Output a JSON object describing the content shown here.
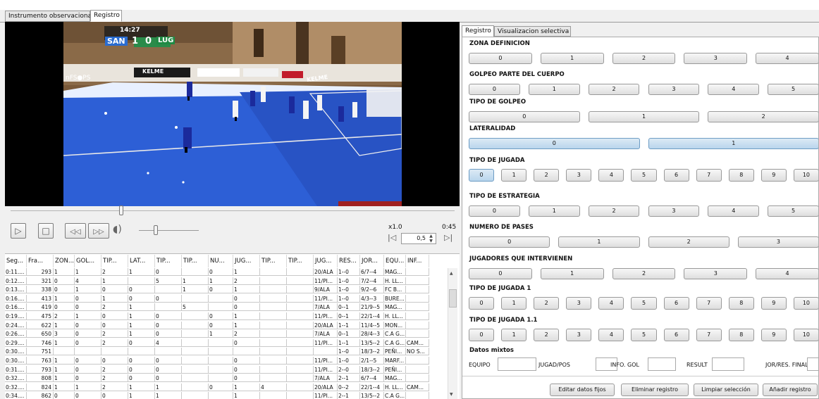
{
  "tabs": {
    "main": [
      "Instrumento observacional",
      "Registro"
    ],
    "right": [
      "Registro",
      "Visualizacion selectiva"
    ]
  },
  "video": {
    "scoreboard": {
      "time": "14:27",
      "home": "SAN",
      "home_score": "1",
      "away_score": "0",
      "away": "LUG"
    },
    "banners": [
      "KELME",
      "nFS●PS",
      "KELME"
    ]
  },
  "player": {
    "speed": "x1.0",
    "time": "0:45",
    "step": "0,5"
  },
  "table": {
    "headers": [
      "Seg...",
      "Fra...",
      "ZON...",
      "GOL...",
      "TIP...",
      "LAT...",
      "TIP...",
      "TIP...",
      "NU...",
      "JUG...",
      "TIP...",
      "TIP...",
      "JUG...",
      "RES...",
      "JOR...",
      "EQU...",
      "INF..."
    ],
    "rows": [
      [
        "0:11....",
        "293",
        "1",
        "1",
        "2",
        "1",
        "0",
        "",
        "0",
        "1",
        "",
        "",
        "20/ALA",
        "1--0",
        "6/7--4",
        "MAG...",
        ""
      ],
      [
        "0:12....",
        "321",
        "0",
        "4",
        "1",
        "",
        "5",
        "1",
        "1",
        "2",
        "",
        "",
        "11/PI...",
        "1--0",
        "7/2--4",
        "H. LL...",
        ""
      ],
      [
        "0:13....",
        "338",
        "0",
        "1",
        "0",
        "0",
        "",
        "1",
        "0",
        "1",
        "",
        "",
        "9/ALA",
        "1--0",
        "9/2--6",
        "FC B...",
        ""
      ],
      [
        "0:16....",
        "413",
        "1",
        "0",
        "1",
        "0",
        "0",
        "",
        "",
        "0",
        "",
        "",
        "11/PI...",
        "1--0",
        "4/3--3",
        "BURE...",
        ""
      ],
      [
        "0:16....",
        "419",
        "0",
        "0",
        "2",
        "1",
        "",
        "5",
        "",
        "0",
        "",
        "",
        "7/ALA",
        "0--1",
        "21/9--5",
        "MAG...",
        ""
      ],
      [
        "0:19....",
        "475",
        "2",
        "1",
        "0",
        "1",
        "0",
        "",
        "0",
        "1",
        "",
        "",
        "11/PI...",
        "0--1",
        "22/1--4",
        "H. LL...",
        ""
      ],
      [
        "0:24....",
        "622",
        "1",
        "0",
        "0",
        "1",
        "0",
        "",
        "0",
        "1",
        "",
        "",
        "20/ALA",
        "1--1",
        "11/4--5",
        "MON...",
        ""
      ],
      [
        "0:26....",
        "650",
        "3",
        "0",
        "2",
        "1",
        "0",
        "",
        "1",
        "2",
        "",
        "",
        "7/ALA",
        "0--1",
        "28/4--3",
        "C.A G...",
        ""
      ],
      [
        "0:29....",
        "746",
        "1",
        "0",
        "2",
        "0",
        "4",
        "",
        "",
        "0",
        "",
        "",
        "11/PI...",
        "1--1",
        "13/5--2",
        "C.A G...",
        "CAM..."
      ],
      [
        "0:30....",
        "751",
        "",
        "",
        "",
        "",
        "",
        "",
        "",
        "",
        "",
        "",
        "",
        "1--0",
        "18/3--2",
        "PEÑI...",
        "NO S..."
      ],
      [
        "0:30....",
        "763",
        "1",
        "0",
        "0",
        "0",
        "0",
        "",
        "",
        "0",
        "",
        "",
        "11/PI...",
        "1--0",
        "2/1--5",
        "MARF...",
        ""
      ],
      [
        "0:31....",
        "793",
        "1",
        "0",
        "2",
        "0",
        "0",
        "",
        "",
        "0",
        "",
        "",
        "11/PI...",
        "2--0",
        "18/3--2",
        "PEÑI...",
        ""
      ],
      [
        "0:32....",
        "808",
        "1",
        "0",
        "2",
        "0",
        "0",
        "",
        "",
        "0",
        "",
        "",
        "7/ALA",
        "2--1",
        "6/7--4",
        "MAG...",
        ""
      ],
      [
        "0:32....",
        "824",
        "1",
        "1",
        "2",
        "1",
        "1",
        "",
        "0",
        "1",
        "4",
        "",
        "20/ALA",
        "0--2",
        "22/1--4",
        "H. LL...",
        "CAM..."
      ],
      [
        "0:34....",
        "862",
        "0",
        "0",
        "0",
        "1",
        "1",
        "",
        "",
        "1",
        "",
        "",
        "11/PI...",
        "2--1",
        "13/5--2",
        "C.A G...",
        ""
      ]
    ]
  },
  "sections": [
    {
      "title": "ZONA DEFINICION",
      "buttons": [
        "0",
        "1",
        "2",
        "3",
        "4"
      ]
    },
    {
      "title": "GOLPEO PARTE DEL CUERPO",
      "buttons": [
        "0",
        "1",
        "2",
        "3",
        "4",
        "5"
      ]
    },
    {
      "title": "TIPO DE GOLPEO",
      "buttons": [
        "0",
        "1",
        "2"
      ]
    },
    {
      "title": "LATERALIDAD",
      "buttons": [
        "0",
        "1"
      ]
    },
    {
      "title": "TIPO DE JUGADA",
      "buttons": [
        "0",
        "1",
        "2",
        "3",
        "4",
        "5",
        "6",
        "7",
        "8",
        "9",
        "10"
      ]
    },
    {
      "title": "TIPO DE ESTRATEGIA",
      "buttons": [
        "0",
        "1",
        "2",
        "3",
        "4",
        "5"
      ]
    },
    {
      "title": "NUMERO DE PASES",
      "buttons": [
        "0",
        "1",
        "2",
        "3"
      ]
    },
    {
      "title": "JUGADORES QUE INTERVIENEN",
      "buttons": [
        "0",
        "1",
        "2",
        "3",
        "4"
      ]
    },
    {
      "title": "TIPO DE JUGADA 1",
      "buttons": [
        "0",
        "1",
        "2",
        "3",
        "4",
        "5",
        "6",
        "7",
        "8",
        "9",
        "10"
      ]
    },
    {
      "title": "TIPO DE JUGADA 1.1",
      "buttons": [
        "0",
        "1",
        "2",
        "3",
        "4",
        "5",
        "6",
        "7",
        "8",
        "9",
        "10"
      ]
    }
  ],
  "mixed": {
    "title": "Datos mixtos",
    "fields": [
      "EQUIPO",
      "JUGAD/POS",
      "INFO. GOL",
      "RESULT",
      "JOR/RES. FINAL"
    ]
  },
  "actions": [
    "Editar datos fijos",
    "Eliminar registro",
    "Limpiar selección",
    "Añadir registro"
  ],
  "colors": {
    "court": "#2d5fd6",
    "selected": "#c6dcef",
    "panel": "#ffffff"
  }
}
